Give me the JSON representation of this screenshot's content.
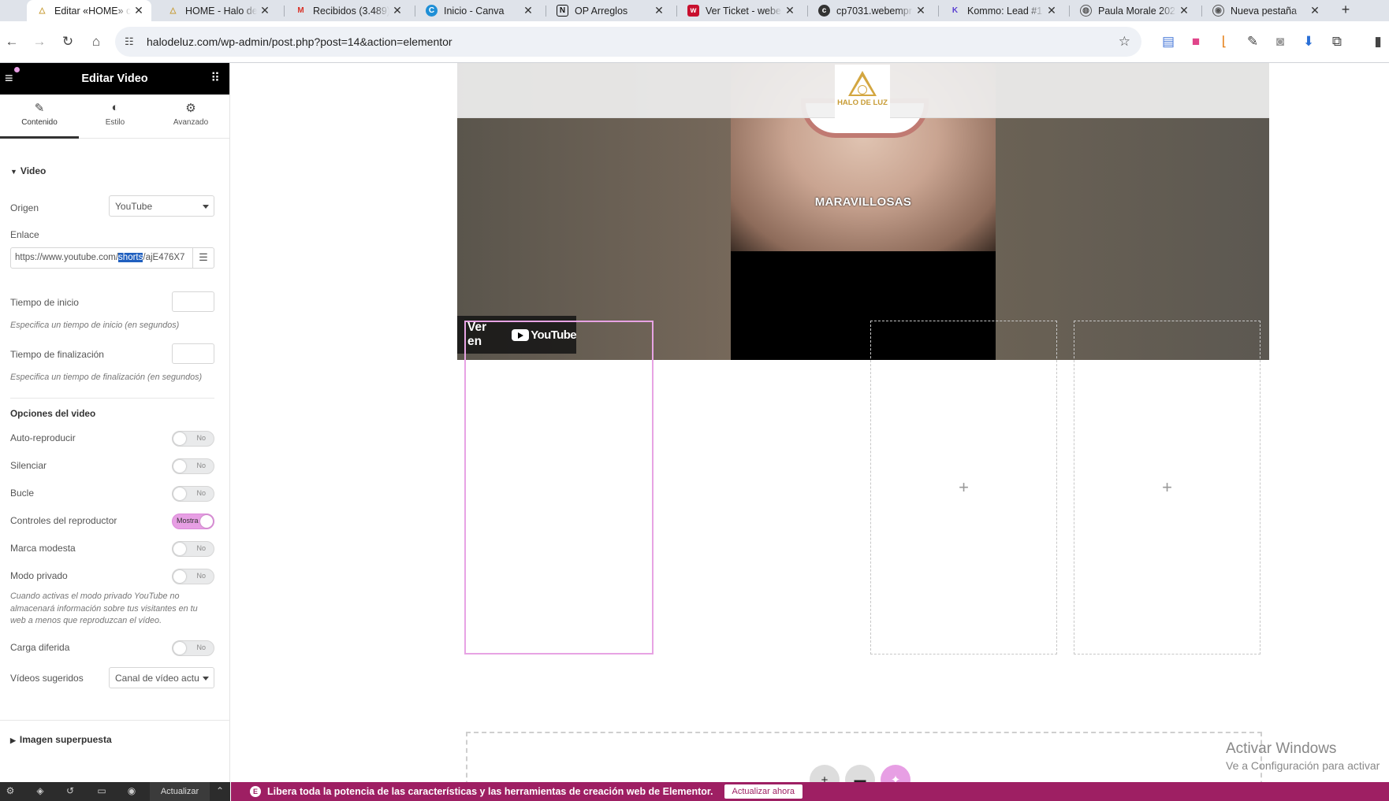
{
  "browser": {
    "tabs": [
      {
        "title": "Editar «HOME» co",
        "icon": "halo-favicon",
        "active": true
      },
      {
        "title": "HOME - Halo de l",
        "icon": "halo-favicon"
      },
      {
        "title": "Recibidos (3.489)",
        "icon": "gmail-icon"
      },
      {
        "title": "Inicio - Canva",
        "icon": "canva-icon"
      },
      {
        "title": "OP Arreglos",
        "icon": "notion-icon"
      },
      {
        "title": "Ver Ticket - weber",
        "icon": "webempresa-icon"
      },
      {
        "title": "cp7031.webempr",
        "icon": "cpanel-icon"
      },
      {
        "title": "Kommo: Lead #1",
        "icon": "kommo-icon"
      },
      {
        "title": "Paula Morale 202",
        "icon": "globe-icon"
      },
      {
        "title": "Nueva pestaña",
        "icon": "chrome-icon"
      }
    ],
    "url": "halodeluz.com/wp-admin/post.php?post=14&action=elementor"
  },
  "panel": {
    "title": "Editar Video",
    "tabs": [
      {
        "label": "Contenido",
        "icon": "pencil-icon"
      },
      {
        "label": "Estilo",
        "icon": "contrast-icon"
      },
      {
        "label": "Avanzado",
        "icon": "gear-icon"
      }
    ],
    "section_video": "Video",
    "origen_label": "Origen",
    "origen_value": "YouTube",
    "enlace_label": "Enlace",
    "enlace_pre": "https://www.youtube.com/",
    "enlace_sel": "shorts",
    "enlace_post": "/ajE476X7",
    "inicio_label": "Tiempo de inicio",
    "inicio_desc": "Especifica un tiempo de inicio (en segundos)",
    "fin_label": "Tiempo de finalización",
    "fin_desc": "Especifica un tiempo de finalización (en segundos)",
    "opciones_heading": "Opciones del video",
    "toggles": [
      {
        "label": "Auto-reproducir",
        "state": "No"
      },
      {
        "label": "Silenciar",
        "state": "No"
      },
      {
        "label": "Bucle",
        "state": "No"
      },
      {
        "label": "Controles del reproductor",
        "state": "Mostra"
      },
      {
        "label": "Marca modesta",
        "state": "No"
      },
      {
        "label": "Modo privado",
        "state": "No"
      }
    ],
    "privado_desc": "Cuando activas el modo privado YouTube no almacenará información sobre tus visitantes en tu web a menos que reproduzcan el vídeo.",
    "carga_label": "Carga diferida",
    "carga_state": "No",
    "sugeridos_label": "Vídeos sugeridos",
    "sugeridos_value": "Canal de vídeo actual",
    "section_overlay": "Imagen superpuesta",
    "footer_update": "Actualizar"
  },
  "canvas": {
    "logo_text": "HALO DE LUZ",
    "video_caption": "MARAVILLOSAS",
    "watch_on": "Ver en",
    "youtube": "YouTube",
    "plus": "+",
    "watermark_title": "Activar Windows",
    "watermark_sub": "Ve a Configuración para activar",
    "promo_text": "Libera toda la potencia de las características y las herramientas de creación web de Elementor.",
    "promo_button": "Actualizar ahora"
  },
  "colors": {
    "accent": "#9e1f63",
    "selected_outline": "#e7a3e4",
    "toggle_on": "#e79fe4"
  }
}
